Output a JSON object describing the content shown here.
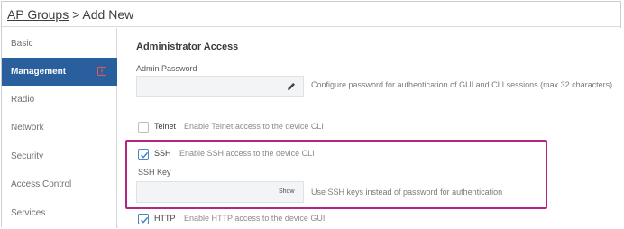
{
  "breadcrumb": {
    "parent": "AP Groups",
    "separator": " > ",
    "current": "Add New"
  },
  "sidebar": {
    "items": [
      {
        "label": "Basic"
      },
      {
        "label": "Management"
      },
      {
        "label": "Radio"
      },
      {
        "label": "Network"
      },
      {
        "label": "Security"
      },
      {
        "label": "Access Control"
      },
      {
        "label": "Services"
      }
    ],
    "active_index": 1
  },
  "admin": {
    "section_title": "Administrator Access",
    "password_label": "Admin Password",
    "password_value": "",
    "password_help": "Configure password for authentication of GUI and CLI sessions (max 32 characters)"
  },
  "telnet": {
    "label": "Telnet",
    "description": "Enable Telnet access to the device CLI",
    "checked": false
  },
  "ssh": {
    "label": "SSH",
    "description": "Enable SSH access to the device CLI",
    "checked": true,
    "key_label": "SSH Key",
    "key_value": "",
    "show_label": "Show",
    "key_help": "Use SSH keys instead of password for authentication"
  },
  "http": {
    "label": "HTTP",
    "description": "Enable HTTP access to the device GUI",
    "checked": true
  },
  "colors": {
    "active_nav": "#2a5f9e",
    "highlight": "#b3257f",
    "checkbox": "#4a86c5",
    "error": "#d9534f"
  }
}
